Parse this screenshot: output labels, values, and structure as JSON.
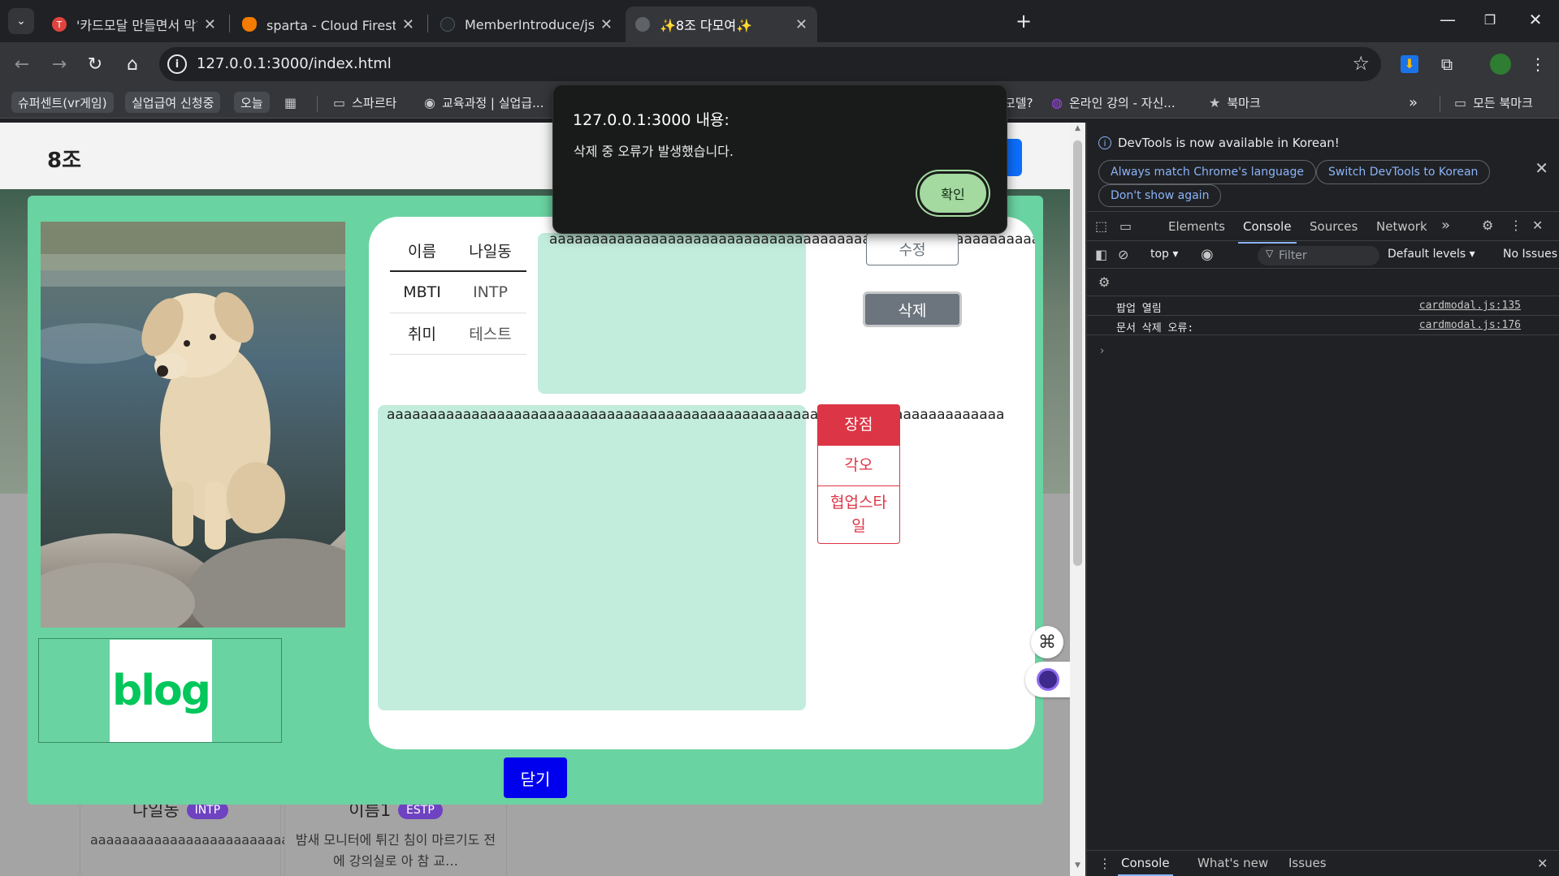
{
  "browser": {
    "tabs": [
      {
        "title": "'카드모달 만들면서 막히는 부분",
        "close": "✕"
      },
      {
        "title": "sparta - Cloud Firestore - 데이터",
        "close": "✕"
      },
      {
        "title": "MemberIntroduce/js/cardmodal.js",
        "close": "✕"
      },
      {
        "title": "✨8조 다모여✨",
        "close": "✕"
      }
    ],
    "new_tab": "+",
    "window_controls": {
      "minimize": "—",
      "restore": "❐",
      "close": "✕"
    },
    "url": "127.0.0.1:3000/index.html",
    "bookmarks": [
      {
        "label": "슈퍼센트(vr게임)"
      },
      {
        "label": "실업급여 신청중"
      },
      {
        "label": "오늘"
      },
      {
        "label": "스파르타"
      },
      {
        "label": "교육과정 | 실업급..."
      },
      {
        "label": "모델?"
      },
      {
        "label": "온라인 강의 - 자신..."
      },
      {
        "label": "북마크"
      },
      {
        "label": "모든 북마크"
      }
    ],
    "bookmark_overflow": "»"
  },
  "alert": {
    "title": "127.0.0.1:3000 내용:",
    "message": "삭제 중 오류가 발생했습니다.",
    "ok_label": "확인"
  },
  "site": {
    "logo": "8조"
  },
  "modal": {
    "info_rows": [
      {
        "label": "이름",
        "value": "나일동"
      },
      {
        "label": "MBTI",
        "value": "INTP"
      },
      {
        "label": "취미",
        "value": "테스트"
      }
    ],
    "intro_text": "aaaaaaaaaaaaaaaaaaaaaaaaaaaaaaaaaaaaaaaaaaaaaaaaaaaaaaaaaaa",
    "detail_text": "aaaaaaaaaaaaaaaaaaaaaaaaaaaaaaaaaaaaaaaaaaaaaaaaaaaaaaaaaaaaaaaaaaaaaaaaa",
    "edit_label": "수정",
    "delete_label": "삭제",
    "tabs": [
      "장점",
      "각오",
      "협업스타일"
    ],
    "blog_logo": "blog",
    "close_label": "닫기"
  },
  "member_cards": [
    {
      "name": "나일동",
      "mbti": "INTP",
      "desc": "aaaaaaaaaaaaaaaaaaaaaaaaa"
    },
    {
      "name": "이름1",
      "mbti": "ESTP",
      "desc": "밤새 모니터에 튀긴 침이 마르기도 전에 강의실로 아 참 교…"
    }
  ],
  "devtools": {
    "banner": "DevTools is now available in Korean!",
    "banner_buttons": [
      "Always match Chrome's language",
      "Switch DevTools to Korean",
      "Don't show again"
    ],
    "tabs": [
      "Elements",
      "Console",
      "Sources",
      "Network"
    ],
    "context": "top ▾",
    "filter_placeholder": "Filter",
    "levels": "Default levels ▾",
    "issues": "No Issues",
    "logs": [
      {
        "text": "팝업 열림",
        "source": "cardmodal.js:135"
      },
      {
        "text": "문서 삭제 오류:",
        "source": "cardmodal.js:176"
      }
    ],
    "prompt": "›",
    "drawer_tabs": [
      "Console",
      "What's new",
      "Issues"
    ]
  },
  "colors": {
    "modal_bg": "#6ad3a2",
    "text_box_bg": "#c2ecdb",
    "danger": "#dc3545",
    "close_btn": "#0000ee",
    "alert_ok": "#a4d9a0"
  }
}
